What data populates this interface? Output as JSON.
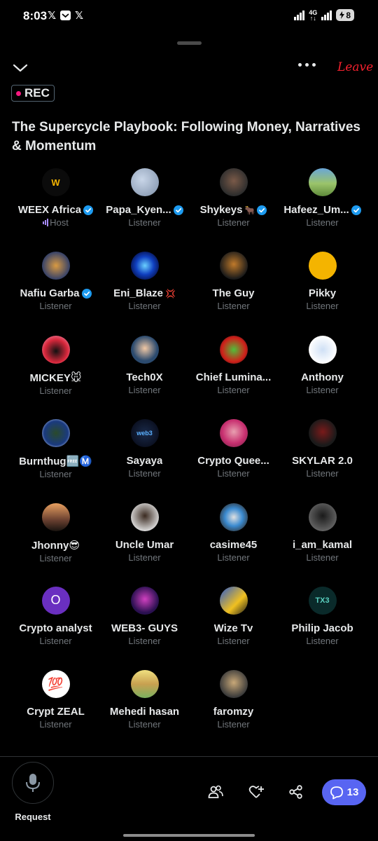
{
  "status_bar": {
    "time": "8:03",
    "app_icons": [
      "x-icon",
      "mailbox-icon",
      "x-icon"
    ],
    "network": "4G",
    "battery": "8"
  },
  "topbar": {
    "leave_label": "Leave",
    "more_icon": "more-icon",
    "collapse_icon": "chevron-down-icon"
  },
  "rec_label": "REC",
  "title": "The Supercycle Playbook: Following Money, Narratives & Momentum",
  "participants": [
    {
      "name": "WEEX Africa",
      "role": "Host",
      "verified": true
    },
    {
      "name": "Papa_Kyen...",
      "role": "Listener",
      "verified": true
    },
    {
      "name": "Shykeys",
      "role": "Listener",
      "verified": true,
      "emoji": "🐂"
    },
    {
      "name": "Hafeez_Um...",
      "role": "Listener",
      "verified": true
    },
    {
      "name": "Nafiu Garba",
      "role": "Listener",
      "verified": true
    },
    {
      "name": "Eni_Blaze",
      "role": "Listener",
      "verified": false,
      "emoji": "💢"
    },
    {
      "name": "The Guy",
      "role": "Listener",
      "verified": false
    },
    {
      "name": "Pikky",
      "role": "Listener",
      "verified": false
    },
    {
      "name": "MICKEY🐭",
      "role": "Listener",
      "verified": false
    },
    {
      "name": "Tech0X",
      "role": "Listener",
      "verified": false
    },
    {
      "name": "Chief Lumina...",
      "role": "Listener",
      "verified": false
    },
    {
      "name": "Anthony",
      "role": "Listener",
      "verified": false
    },
    {
      "name": "Burnthug🆓Ⓜ️",
      "role": "Listener",
      "verified": false
    },
    {
      "name": "Sayaya",
      "role": "Listener",
      "verified": false
    },
    {
      "name": "Crypto Quee...",
      "role": "Listener",
      "verified": false
    },
    {
      "name": "SKYLAR 2.0",
      "role": "Listener",
      "verified": false
    },
    {
      "name": "Jhonny😎",
      "role": "Listener",
      "verified": false
    },
    {
      "name": "Uncle Umar",
      "role": "Listener",
      "verified": false
    },
    {
      "name": "casime45",
      "role": "Listener",
      "verified": false
    },
    {
      "name": "i_am_kamal",
      "role": "Listener",
      "verified": false
    },
    {
      "name": "Crypto analyst",
      "role": "Listener",
      "verified": false,
      "initial": "O"
    },
    {
      "name": "WEB3- GUYS",
      "role": "Listener",
      "verified": false
    },
    {
      "name": "Wize Tv",
      "role": "Listener",
      "verified": false
    },
    {
      "name": "Philip Jacob",
      "role": "Listener",
      "verified": false
    },
    {
      "name": "Crypt ZEAL",
      "role": "Listener",
      "verified": false,
      "initial": "💯"
    },
    {
      "name": "Mehedi hasan",
      "role": "Listener",
      "verified": false
    },
    {
      "name": "faromzy",
      "role": "Listener",
      "verified": false
    }
  ],
  "bottom_bar": {
    "request_label": "Request",
    "comments_count": "13",
    "people_icon": "people-icon",
    "heart_icon": "heart-plus-icon",
    "share_icon": "share-icon"
  },
  "colors": {
    "background": "#000000",
    "leave": "#f4212e",
    "verified": "#1d9bf0",
    "comments_button": "#5865f2",
    "rec_dot": "#f91880"
  }
}
